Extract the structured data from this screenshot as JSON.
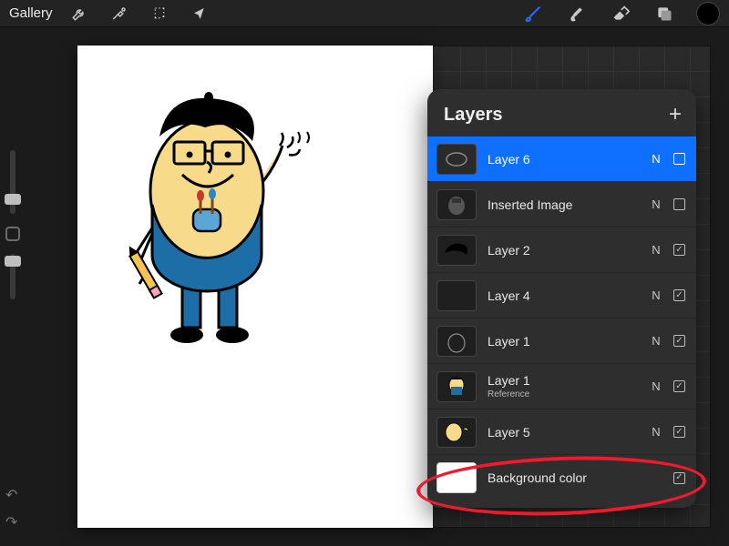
{
  "topbar": {
    "gallery_label": "Gallery",
    "brush_color": "#2a6dff",
    "swatch_color": "#000000"
  },
  "layers_panel": {
    "title": "Layers",
    "items": [
      {
        "name": "Layer 6",
        "blend": "N",
        "visible": false,
        "selected": true,
        "thumb": "ellipse-outline"
      },
      {
        "name": "Inserted Image",
        "blend": "N",
        "visible": false,
        "selected": false,
        "thumb": "char-gray"
      },
      {
        "name": "Layer 2",
        "blend": "N",
        "visible": true,
        "selected": false,
        "thumb": "black-shape"
      },
      {
        "name": "Layer 4",
        "blend": "N",
        "visible": true,
        "selected": false,
        "thumb": "empty"
      },
      {
        "name": "Layer 1",
        "blend": "N",
        "visible": true,
        "selected": false,
        "thumb": "char-outline"
      },
      {
        "name": "Layer 1",
        "sub": "Reference",
        "blend": "N",
        "visible": true,
        "selected": false,
        "thumb": "char-blue"
      },
      {
        "name": "Layer 5",
        "blend": "N",
        "visible": true,
        "selected": false,
        "thumb": "char-yellow"
      },
      {
        "name": "Background color",
        "blend": "",
        "visible": true,
        "selected": false,
        "thumb": "white"
      }
    ]
  },
  "annotation": {
    "highlight_row_index": 7
  },
  "canvas": {
    "background": "#ffffff",
    "character_colors": {
      "skin": "#f7db8a",
      "overalls": "#1d6ea7",
      "pencil": "#f4c352",
      "eraser": "#f5a3b7"
    }
  }
}
